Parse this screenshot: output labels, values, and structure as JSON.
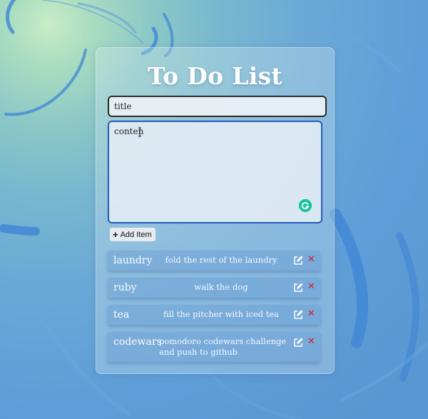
{
  "header": {
    "title": "To Do List"
  },
  "form": {
    "title_value": "title",
    "content_value": "conten",
    "add_button_label": "Add Item"
  },
  "icons": {
    "add": "plus-icon",
    "edit": "edit-icon",
    "delete": "close-icon",
    "grammarly": "grammarly-icon"
  },
  "colors": {
    "delete_accent": "#d0202a",
    "focus_border": "#2b62b8",
    "grammarly": "#15c39a"
  },
  "items": [
    {
      "title": "laundry",
      "content": "fold the rest of the laundry"
    },
    {
      "title": "ruby",
      "content": "walk the dog"
    },
    {
      "title": "tea",
      "content": "fill the pitcher with iced tea"
    },
    {
      "title": "codewars",
      "content": "pomodoro codewars challenge and push to github"
    }
  ]
}
